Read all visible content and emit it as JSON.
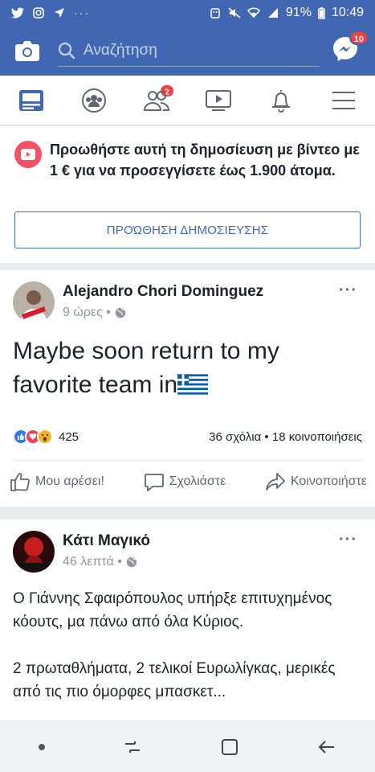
{
  "statusbar": {
    "battery": "91%",
    "time": "10:49"
  },
  "header": {
    "search_placeholder": "Αναζήτηση",
    "messenger_badge": "10"
  },
  "tabs": {
    "groups_badge": "2"
  },
  "promo": {
    "text": "Προωθήστε αυτή τη δημοσίευση με βίντεο με 1 € για να προσεγγίσετε έως 1.900 άτομα.",
    "button": "ΠΡΟΏΘΗΣΗ ΔΗΜΟΣΙΕΥΣΗΣ"
  },
  "post1": {
    "author": "Alejandro Chori Dominguez",
    "time": "9 ώρες •",
    "text": "Maybe soon return to my favorite team in",
    "reaction_count": "425",
    "stats": "36 σχόλια • 18 κοινοποιήσεις",
    "like_label": "Μου αρέσει!",
    "comment_label": "Σχολιάστε",
    "share_label": "Κοινοποιήστε"
  },
  "post2": {
    "author": "Κάτι Μαγικό",
    "time": "46 λεπτά •",
    "paragraph1": "Ο Γιάννης Σφαιρόπουλος υπήρξε επιτυχημένος κόουτς, μα πάνω από όλα Κύριος.",
    "paragraph2": "2 πρωταθλήματα, 2 τελικοί Ευρωλίγκας, μερικές από τις πιο όμορφες μπασκετ..."
  },
  "colors": {
    "brand": "#4267b2",
    "badge": "#fa3e3e"
  }
}
